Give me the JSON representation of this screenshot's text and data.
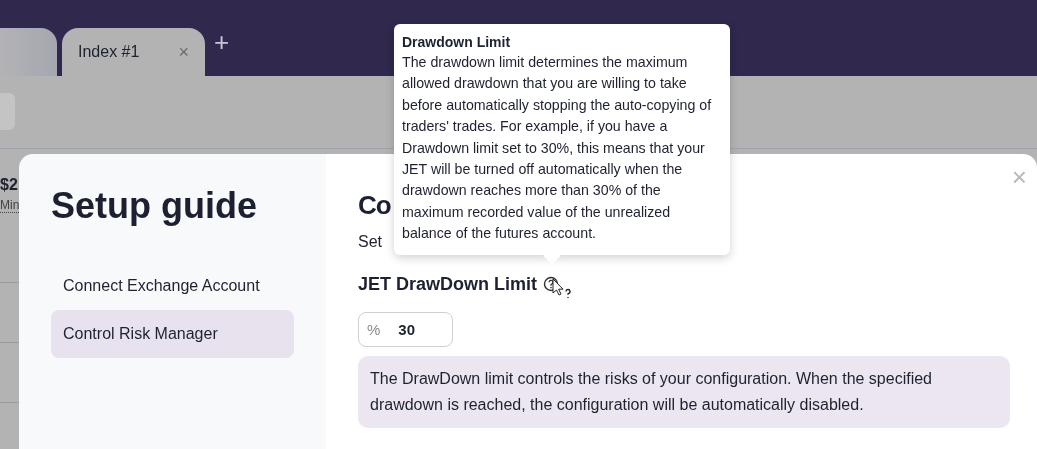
{
  "tabs": [
    {
      "kind": "partial",
      "selected": false
    },
    {
      "kind": "tab",
      "label": "Index #1",
      "selected": true,
      "close": "×"
    }
  ],
  "new_tab": "+",
  "background": {
    "peek_texts": [
      "$2",
      "Min"
    ]
  },
  "modal": {
    "title": "Setup guide",
    "close": "×",
    "steps": [
      {
        "label": "Connect Exchange Account",
        "selected": false
      },
      {
        "label": "Control Risk Manager",
        "selected": true
      }
    ],
    "heading": "Co",
    "subtitle": "Set",
    "field_label": "JET DrawDown Limit",
    "field": {
      "prefix": "%",
      "value": "30"
    },
    "note": "The DrawDown limit controls the risks of your configuration. When the specified drawdown is reached, the configuration will be automatically disabled."
  },
  "tooltip": {
    "title": "Drawdown Limit",
    "text": "The drawdown limit determines the maximum allowed drawdown that you are willing to take before automatically stopping the auto-copying of traders' trades. For example, if you have a Drawdown limit set to 30%, this means that your JET will be turned off automatically when the drawdown reaches more than 30% of the maximum recorded value of the unrealized balance of the futures account."
  }
}
